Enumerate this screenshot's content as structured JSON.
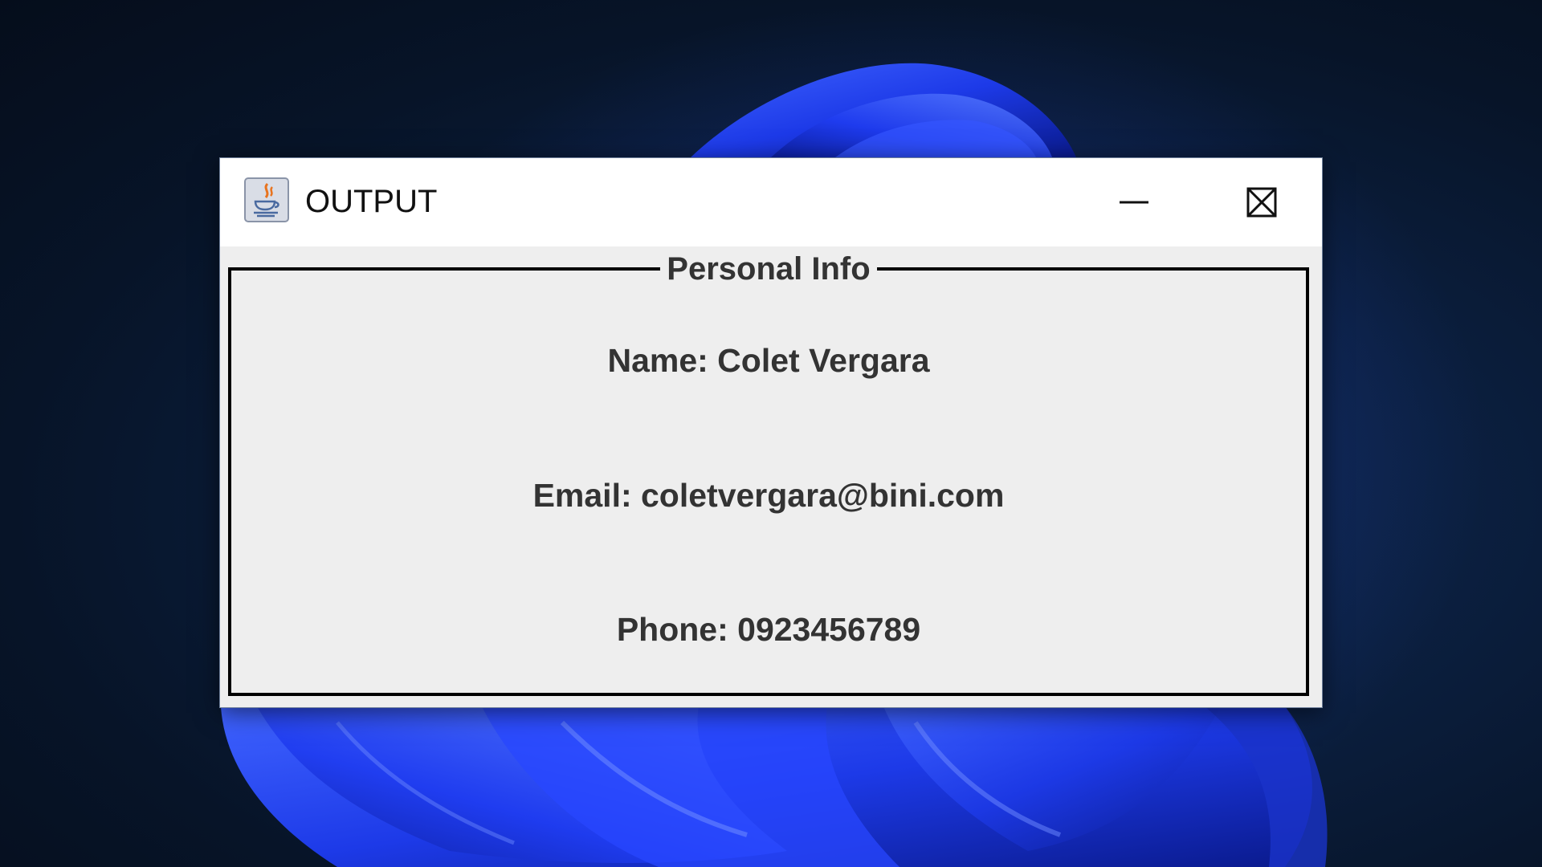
{
  "window": {
    "title": "OUTPUT",
    "icon": "java-cup-icon",
    "controls": {
      "minimize": "minimize-icon",
      "maximize": "maximize-icon",
      "close": "close-icon"
    }
  },
  "panel": {
    "legend": "Personal Info",
    "lines": [
      "Name: Colet Vergara",
      "Email: coletvergara@bini.com",
      "Phone: 0923456789"
    ]
  },
  "colors": {
    "desktop_background": "#071428",
    "wallpaper_bloom": "#1f3cff",
    "title_bar": "#ffffff",
    "window_body": "#eeeeee",
    "text": "#333333",
    "border": "#000000"
  }
}
